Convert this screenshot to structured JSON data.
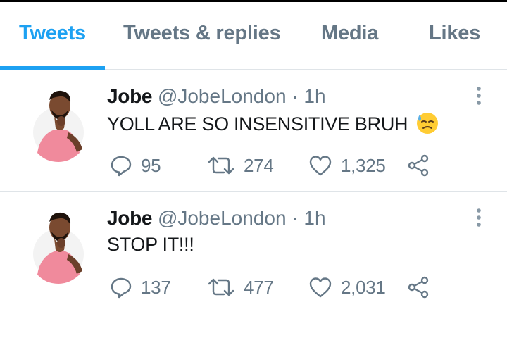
{
  "tabs": [
    {
      "label": "Tweets",
      "active": true
    },
    {
      "label": "Tweets & replies",
      "active": false
    },
    {
      "label": "Media",
      "active": false
    },
    {
      "label": "Likes",
      "active": false
    }
  ],
  "colors": {
    "accent": "#1da1f2",
    "muted": "#657786",
    "text": "#14171a",
    "divider": "#dfe4e8"
  },
  "tweets": [
    {
      "name": "Jobe",
      "handle": "@JobeLondon",
      "separator": "·",
      "time": "1h",
      "text": "YOLL ARE SO INSENSITIVE BRUH",
      "emoji": "downcast-face-with-sweat-icon",
      "reply_count": "95",
      "retweet_count": "274",
      "like_count": "1,325"
    },
    {
      "name": "Jobe",
      "handle": "@JobeLondon",
      "separator": "·",
      "time": "1h",
      "text": "STOP IT!!!",
      "reply_count": "137",
      "retweet_count": "477",
      "like_count": "2,031"
    }
  ],
  "icons": {
    "avatar": "profile-avatar-man-pink-shirt",
    "more": "more-vertical-icon",
    "reply": "reply-bubble-icon",
    "retweet": "retweet-icon",
    "like": "heart-icon",
    "share": "share-icon"
  }
}
